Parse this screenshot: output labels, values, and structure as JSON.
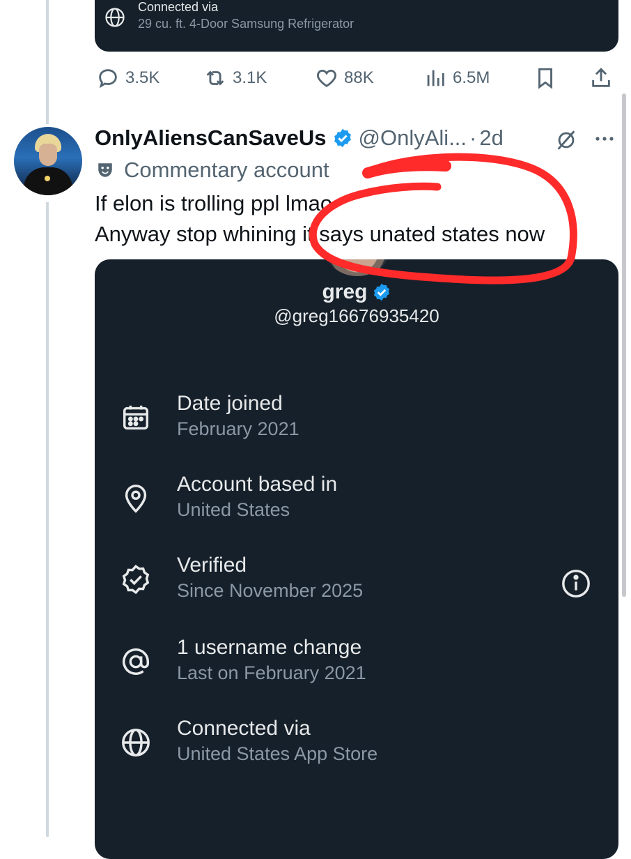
{
  "top_card": {
    "line1": "Connected via",
    "line2": "29 cu. ft. 4-Door Samsung Refrigerator"
  },
  "actions": {
    "replies": "3.5K",
    "reposts": "3.1K",
    "likes": "88K",
    "views": "6.5M"
  },
  "tweet": {
    "display_name": "OnlyAliensCanSaveUs",
    "handle": "@OnlyAli...",
    "separator": "·",
    "time": "2d",
    "label": "Commentary account",
    "text_lines": [
      "If elon is trolling ppl lmao",
      "Anyway stop whining it says unated states now"
    ]
  },
  "profile": {
    "name": "greg",
    "handle": "@greg16676935420",
    "items": [
      {
        "title": "Date joined",
        "value": "February 2021",
        "icon": "calendar-icon"
      },
      {
        "title": "Account based in",
        "value": "United States",
        "icon": "location-pin-icon"
      },
      {
        "title": "Verified",
        "value": "Since November 2025",
        "icon": "verified-seal-icon"
      },
      {
        "title": "1 username change",
        "value": "Last on February 2021",
        "icon": "at-sign-icon"
      },
      {
        "title": "Connected via",
        "value": "United States App Store",
        "icon": "globe-icon"
      }
    ]
  },
  "colors": {
    "card_bg": "#16202a",
    "verified_blue": "#1d9bf0",
    "annotation_red": "#ff2a2a",
    "muted": "#536471"
  }
}
